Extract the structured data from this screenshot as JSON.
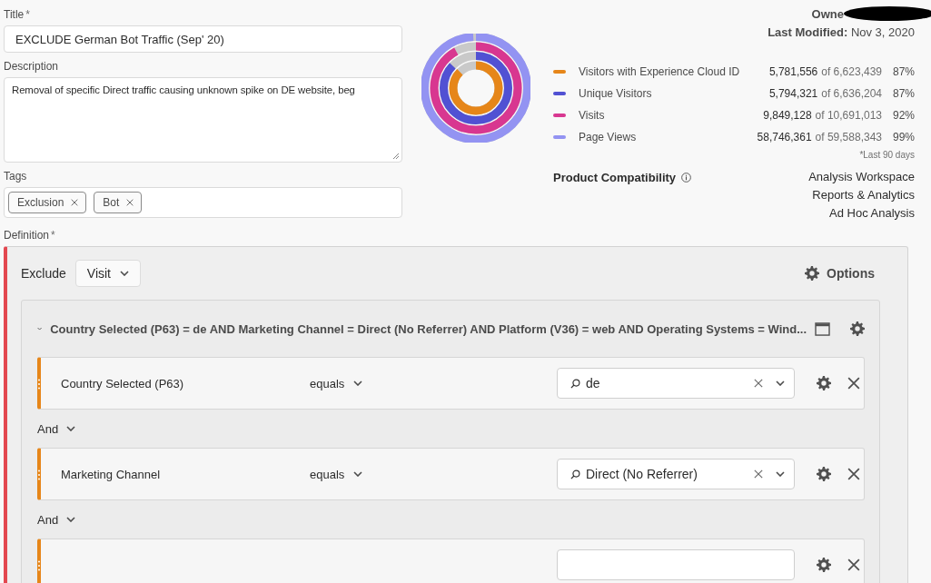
{
  "title_field": {
    "label": "Title",
    "required_mark": "*",
    "value": "EXCLUDE German Bot Traffic (Sep' 20)"
  },
  "description_field": {
    "label": "Description",
    "value": "Removal of specific Direct traffic causing unknown spike on DE website, beg"
  },
  "tags_field": {
    "label": "Tags",
    "tags": [
      {
        "label": "Exclusion"
      },
      {
        "label": "Bot"
      }
    ]
  },
  "owner": {
    "label": "Owne"
  },
  "last_modified": {
    "label": "Last Modified:",
    "value": "Nov 3, 2020"
  },
  "metrics": [
    {
      "name": "Visitors with Experience Cloud ID",
      "count": "5,781,556",
      "total": "of 6,623,439",
      "percent": "87%",
      "level": 0.87,
      "color": "#e68619"
    },
    {
      "name": "Unique Visitors",
      "count": "5,794,321",
      "total": "of 6,636,204",
      "percent": "87%",
      "level": 0.87,
      "color": "#5151d3"
    },
    {
      "name": "Visits",
      "count": "9,849,128",
      "total": "of 10,691,013",
      "percent": "92%",
      "level": 0.92,
      "color": "#d83790"
    },
    {
      "name": "Page Views",
      "count": "58,746,361",
      "total": "of 59,588,343",
      "percent": "99%",
      "level": 0.99,
      "color": "#9393f2"
    }
  ],
  "metrics_note": "*Last 90 days",
  "product_compatibility": {
    "label": "Product Compatibility",
    "products": [
      "Analysis Workspace",
      "Reports & Analytics",
      "Ad Hoc Analysis"
    ]
  },
  "definition": {
    "label": "Definition",
    "required_mark": "*",
    "scope_label": "Exclude",
    "scope_value": "Visit",
    "options_label": "Options",
    "container_summary": "Country Selected (P63) = de AND Marketing Channel = Direct (No Referrer) AND Platform (V36) = web AND Operating Systems = Wind...",
    "conditions": [
      {
        "kind": "full",
        "dimension": "Country Selected (P63)",
        "operator": "equals",
        "value": "de"
      },
      {
        "kind": "full",
        "connector": "And",
        "dimension": "Marketing Channel",
        "operator": "equals",
        "value": "Direct (No Referrer)"
      },
      {
        "kind": "cut",
        "connector": "And"
      }
    ]
  }
}
